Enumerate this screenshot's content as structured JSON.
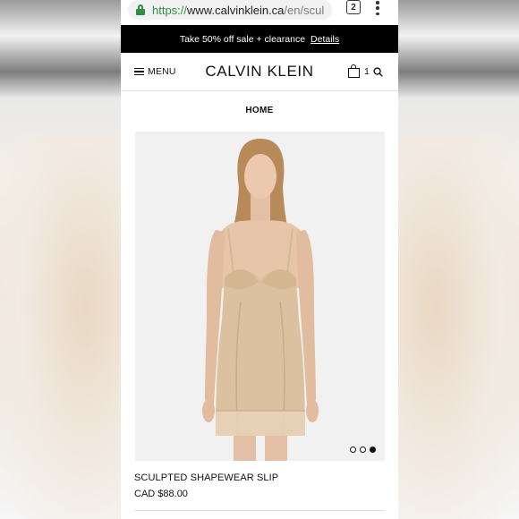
{
  "browser": {
    "url_scheme": "https://",
    "url_host": "www.calvinklein.ca",
    "url_path": "/en/scul",
    "tab_count": "2"
  },
  "promo": {
    "text": "Take 50% off sale + clearance",
    "link": "Details"
  },
  "header": {
    "menu_label": "MENU",
    "brand": "CALVIN KLEIN",
    "cart_count": "1"
  },
  "breadcrumb": "HOME",
  "product": {
    "name": "SCULPTED SHAPEWEAR SLIP",
    "price": "CAD $88.00",
    "image_count": 3,
    "active_image": 3
  },
  "colors": {
    "secure_green": "#2f8f3f",
    "promo_bg": "#000000",
    "image_bg": "#f1f1f1",
    "garment": "#dcc1a0"
  }
}
